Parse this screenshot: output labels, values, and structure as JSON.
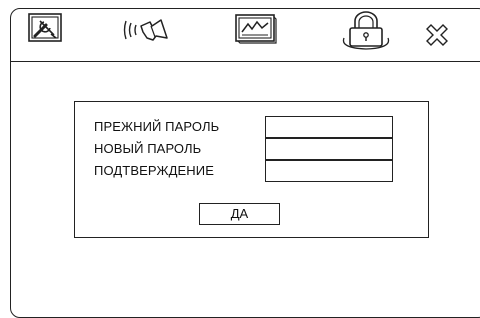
{
  "toolbar": {
    "icons": [
      "tools-icon",
      "speaker-icon",
      "video-icon",
      "lock-icon",
      "close-icon"
    ]
  },
  "password_dialog": {
    "old_password_label": "ПРЕЖНИЙ ПАРОЛЬ",
    "new_password_label": "НОВЫЙ ПАРОЛЬ",
    "confirm_label": "ПОДТВЕРЖДЕНИЕ",
    "old_password_value": "",
    "new_password_value": "",
    "confirm_value": "",
    "ok_button_label": "ДА"
  },
  "colors": {
    "line": "#222222",
    "background": "#ffffff"
  }
}
